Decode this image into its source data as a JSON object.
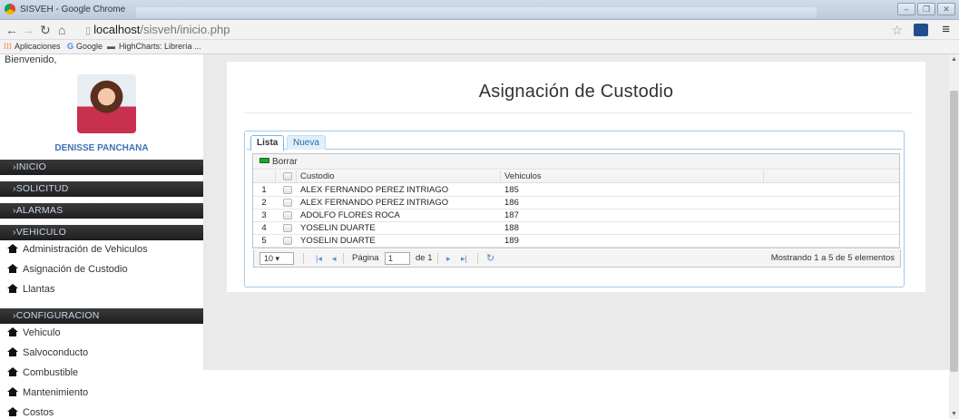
{
  "window": {
    "title": "SISVEH - Google Chrome"
  },
  "browser": {
    "url_host": "localhost",
    "url_path": "/sisveh/inicio.php",
    "bookmarks": [
      "Aplicaciones",
      "Google",
      "HighCharts: Librería ..."
    ]
  },
  "sidebar": {
    "welcome": "Bienvenido,",
    "user_name": "DENISSE PANCHANA",
    "sections": {
      "inicio": "›INICIO",
      "solicitud": "›SOLICITUD",
      "alarmas": "›ALARMAS",
      "vehiculo": "›VEHICULO",
      "configuracion": "›CONFIGURACION"
    },
    "vehiculo_items": [
      "Administración de Vehiculos",
      "Asignación de Custodio",
      "Llantas"
    ],
    "configuracion_items": [
      "Vehiculo",
      "Salvoconducto",
      "Combustible",
      "Mantenimiento",
      "Costos"
    ]
  },
  "main": {
    "title": "Asignación de Custodio",
    "tabs": [
      "Lista",
      "Nueva"
    ],
    "toolbar": {
      "delete_label": "Borrar"
    },
    "table": {
      "columns": [
        "Custodio",
        "Vehiculos"
      ],
      "rows": [
        {
          "n": "1",
          "custodio": "ALEX FERNANDO PEREZ INTRIAGO",
          "vehiculo": "185"
        },
        {
          "n": "2",
          "custodio": "ALEX FERNANDO PEREZ INTRIAGO",
          "vehiculo": "186"
        },
        {
          "n": "3",
          "custodio": "ADOLFO FLORES ROCA",
          "vehiculo": "187"
        },
        {
          "n": "4",
          "custodio": "YOSELIN DUARTE",
          "vehiculo": "188"
        },
        {
          "n": "5",
          "custodio": "YOSELIN DUARTE",
          "vehiculo": "189"
        }
      ]
    },
    "pager": {
      "page_size": "10 ▾",
      "page_label": "Página",
      "page_value": "1",
      "of_label": "de 1",
      "info": "Mostrando 1 a 5 de 5 elementos"
    }
  },
  "colors": {
    "accent": "#3d73b5",
    "menu_dark": "#1e1e1e",
    "tab_border": "#a6c9e2"
  },
  "icons": [
    "home-icon",
    "grid-icon",
    "refresh-icon",
    "first-page-icon",
    "prev-page-icon",
    "next-page-icon",
    "last-page-icon"
  ]
}
